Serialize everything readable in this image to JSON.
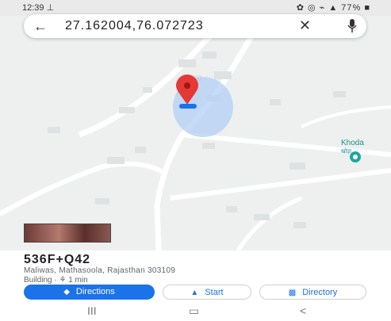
{
  "status_bar": {
    "time": "12:39 ⊥",
    "indicators": "✿ ◎ ⌁ ▲ 77% ■"
  },
  "search": {
    "back_icon": "arrow-left",
    "query": "27.162004,76.072723",
    "clear_icon": "close",
    "mic_icon": "microphone"
  },
  "map": {
    "place_label": "Khoda",
    "place_label_sub": "खोड़ा",
    "dropped_pin_color": "#e53935",
    "location_dot_color": "#1a73e8",
    "accuracy_halo_color": "#b3cff5"
  },
  "place": {
    "title": "536F+Q42",
    "address": "Maliwas, Mathasoola, Rajasthan 303109",
    "subtitle": "Building · ⚘ 1 min"
  },
  "actions": {
    "directions_label": "Directions",
    "start_label": "Start",
    "directory_label": "Directory",
    "accent_color": "#1a73e8"
  },
  "nav_bar": {
    "recents": "III",
    "home": "▭",
    "back": "<"
  }
}
